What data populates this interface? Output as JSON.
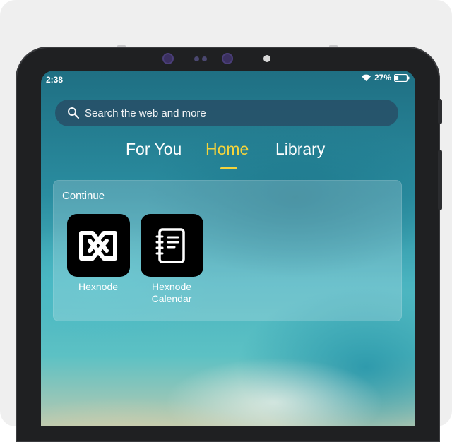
{
  "status_bar": {
    "time": "2:38",
    "battery_percent": "27%",
    "battery_level": 0.27,
    "wifi_icon": "wifi-icon",
    "battery_icon": "battery-icon"
  },
  "search": {
    "placeholder": "Search the web and more",
    "icon": "search-icon"
  },
  "tabs": [
    {
      "label": "For You",
      "active": false
    },
    {
      "label": "Home",
      "active": true
    },
    {
      "label": "Library",
      "active": false
    }
  ],
  "continue_section": {
    "title": "Continue",
    "apps": [
      {
        "label": "Hexnode",
        "icon": "hexnode-logo-icon"
      },
      {
        "label": "Hexnode Calendar",
        "icon": "notebook-icon"
      }
    ]
  },
  "colors": {
    "accent_active_tab": "#f3d33c",
    "device_frame": "#1f2022",
    "app_tile": "#000000"
  }
}
